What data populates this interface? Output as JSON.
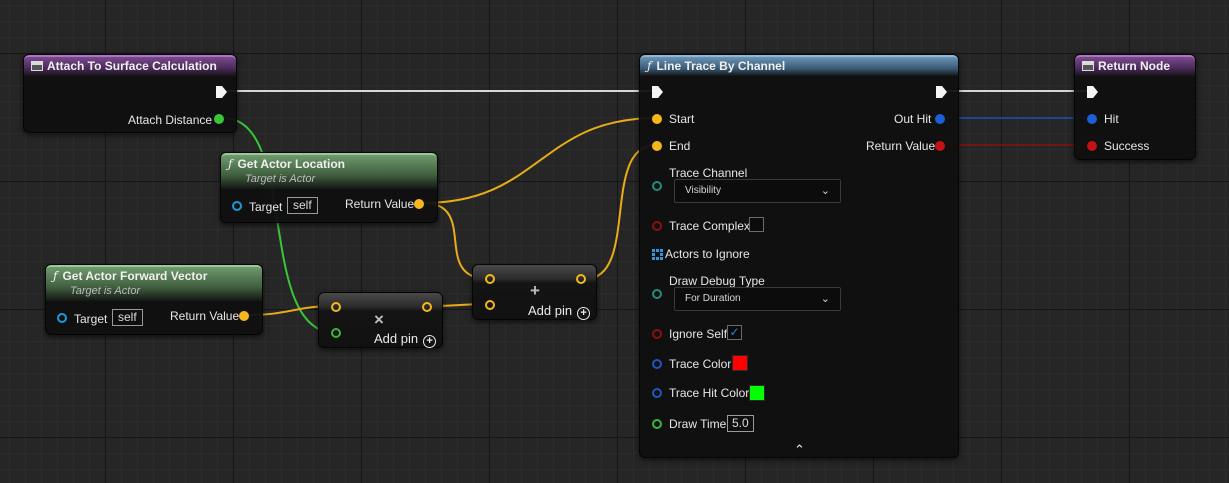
{
  "nodes": {
    "attach": {
      "title": "Attach To Surface Calculation",
      "outputs": {
        "attach_distance": "Attach Distance"
      }
    },
    "get_location": {
      "title": "Get Actor Location",
      "subtitle": "Target is Actor",
      "target_label": "Target",
      "target_value": "self",
      "return_label": "Return Value"
    },
    "get_forward": {
      "title": "Get Actor Forward Vector",
      "subtitle": "Target is Actor",
      "target_label": "Target",
      "target_value": "self",
      "return_label": "Return Value"
    },
    "multiply": {
      "symbol": "×",
      "add_pin_label": "Add pin"
    },
    "add": {
      "symbol": "+",
      "add_pin_label": "Add pin"
    },
    "line_trace": {
      "title": "Line Trace By Channel",
      "inputs": {
        "start": "Start",
        "end": "End",
        "trace_channel": "Trace Channel",
        "trace_channel_value": "Visibility",
        "trace_complex": "Trace Complex",
        "actors_to_ignore": "Actors to Ignore",
        "draw_debug_type": "Draw Debug Type",
        "draw_debug_value": "For Duration",
        "ignore_self": "Ignore Self",
        "trace_color": "Trace Color",
        "trace_hit_color": "Trace Hit Color",
        "draw_time": "Draw Time",
        "draw_time_value": "5.0"
      },
      "outputs": {
        "out_hit": "Out Hit",
        "return_value": "Return Value"
      },
      "trace_complex_checked": false,
      "ignore_self_checked": true,
      "trace_color_hex": "#ff0000",
      "trace_hit_color_hex": "#00ff00"
    },
    "return_node": {
      "title": "Return Node",
      "inputs": {
        "hit": "Hit",
        "success": "Success"
      }
    }
  },
  "icons": {
    "function": "ƒ",
    "chevron_down": "⌄",
    "chevron_up": "⌃",
    "check": "✓",
    "plus": "+"
  },
  "colors": {
    "exec": "#f4f4f4",
    "vector": "#f6b71d",
    "float": "#38c639",
    "struct_hit": "#1d5fd8",
    "bool": "#c01414",
    "object": "#1a9ad8"
  }
}
